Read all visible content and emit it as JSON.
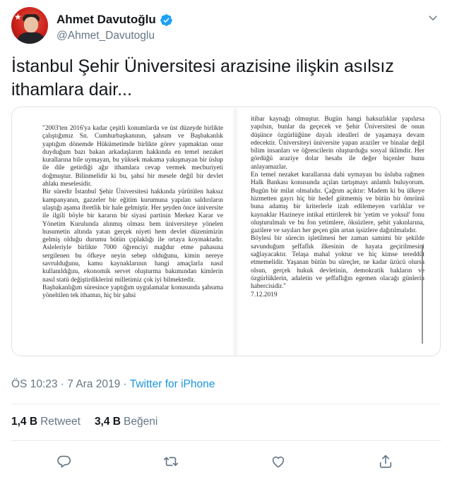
{
  "user": {
    "display_name": "Ahmet Davutoğlu",
    "handle": "@Ahmet_Davutoglu",
    "verified": true,
    "avatar_icon": "profile-photo"
  },
  "tweet": {
    "text": "İstanbul Şehir Üniversitesi arazisine ilişkin asılsız ithamlara dair...",
    "document": {
      "left_column": [
        "\"2003'ten 2016'ya kadar çeşitli konumlarda ve üst düzeyde birlikte çalıştığımız Sn. Cumhurbaşkanının, şahsım ve Başbakanlık yaptığım dönemde Hükümetimde birlikte görev yapmaktan onur duyduğum bazı bakan arkadaşlarım hakkında en temel nezaket kurallarına bile uymayan, bu yüksek makama yakışmayan bir üslup ile dile getirdiği ağır ithamlara cevap vermek mecburiyeti doğmuştur. Bilinmelidir ki bu, şahsi bir mesele değil bir devlet ahlakı meselesidir.",
        "Bir süredir İstanbul Şehir Üniversitesi hakkında yürütülen haksız kampanyanın, gazzeler bir eğitim kurumuna yapılan saldırıların ulaştığı aşama ibretlik bir hale gelmiştir. Her şeyden önce üniversite ile ilgili böyle bir kararın bir siyasi partinin Merkez Karar ve Yönetim Kurulunda alınmış olması hem üniversiteye yönelen husumetin altında yatan gerçek niyeti hem devlet düzenimizin gelmiş olduğu durumu bütün çıplaklığı ile ortaya koymaktadır. Asleleriyle birlikte 7000 öğrenciyi mağdur etme pahasına sergilenen bu öfkeye neyin sebep olduğunu, kimin nereye savrulduğunu, kamu kaynaklarının hangi amaçlarla nasıl kullanıldığını, ekonomik servet oluşturma bakımından kimlerin nasıl statü değiştirdiklerini milletimiz çok iyi bilmektedir.",
        "Başbakanlığım süresince yaptığım uygulamalar konusunda şahsıma yöneltilen tek ithamın, hiç bir şahsi"
      ],
      "right_column": [
        "itibar kaynağı olmuştur. Bugün hangi haksızlıklar yapılırsa yapılsın, bunlar da geçecek ve Şehir Üniversitesi de onun düşünce özgürlüğüne dayalı idealleri de yaşamaya devam edecektir. Üniversiteyi üniversite yapan araziler ve binalar değil bilim insanları ve öğrencilerin oluşturduğu sosyal iklimdir. Her gördüğü araziye dolar hesabı ile değer biçenler bunu anlayamazlar.",
        "En temel nezaket kurallarına dahi uymayan bu üsluba rağmen Halk Bankası konusunda açılan tartışmayı anlamlı buluyorum. Bugün bir milat olmalıdır. Çağrım açıktır: Madem ki bu ülkeye hizmetten gayrı hiç bir hedef gütmemiş ve bütün bir ömrünü buna adamış bir kriterlerle izah edilemeyen varlıklar ve kaynaklar Hazineye intikal ettirilerek bir 'yetim ve yoksul' fonu oluşturulmalı ve bu fon yetimlere, öksüzlere, şehit yakınlarına, gazilere ve sayıları her geçen gün artan işsizlere dağıtılmalıdır.",
        "Böylesi bir sürecin işletilmesi her zaman samimi bir şekilde savunduğum şeffaflık ilkesinin de hayata geçirilmesini sağlayacaktır. Telaşa mahal yoktur ve hiç kimse tereddüt etmemelidir. Yaşanan bütün bu süreçler, ne kadar üzücü olursa olsun, gerçek hukuk devletinin, demokratik hakların ve özgürlüklerin, adaletin ve şeffaflığın egemen olacağı günlerin habercisidir.\"",
        "7.12.2019"
      ]
    },
    "timestamp": "ÖS 10:23 · 7 Ara 2019 · ",
    "source": "Twitter for iPhone",
    "retweets_count": "1,4 B",
    "retweets_label": "Retweet",
    "likes_count": "3,4 B",
    "likes_label": "Beğeni"
  },
  "colors": {
    "accent": "#1b95e0",
    "text": "#14171a",
    "secondary": "#657786",
    "divider": "#e6ecf0"
  },
  "icons": {
    "verified": "verified-badge-icon",
    "caret": "chevron-down-icon",
    "reply": "reply-icon",
    "retweet": "retweet-icon",
    "like": "heart-icon",
    "share": "share-icon"
  }
}
